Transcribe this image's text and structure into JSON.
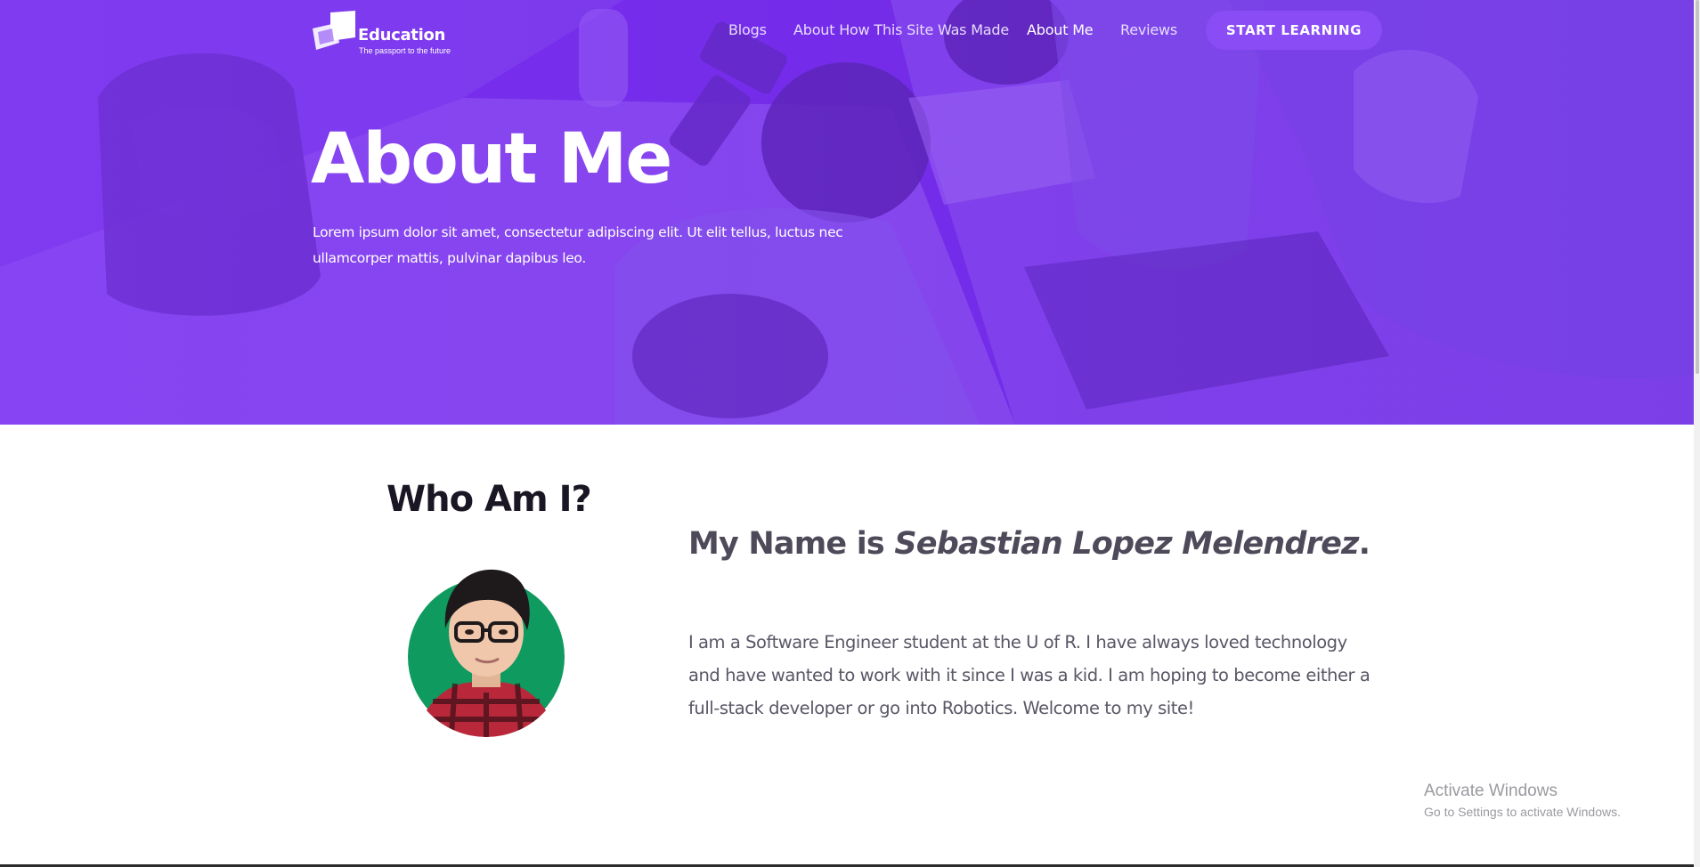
{
  "brand": {
    "name": "Education",
    "tagline": "The passport to the future"
  },
  "nav": {
    "items": [
      {
        "label": "Blogs",
        "active": false
      },
      {
        "label": "About How This Site Was Made",
        "active": false
      },
      {
        "label": "About Me",
        "active": true
      },
      {
        "label": "Reviews",
        "active": false
      }
    ],
    "cta_label": "START LEARNING"
  },
  "hero": {
    "title": "About Me",
    "subtitle": "Lorem ipsum dolor sit amet, consectetur adipiscing elit. Ut elit tellus, luctus nec ullamcorper mattis, pulvinar dapibus leo."
  },
  "about": {
    "heading": "Who Am I?",
    "name_prefix": "My Name is ",
    "name": "Sebastian Lopez Melendrez",
    "name_suffix": ".",
    "bio": "I am a Software Engineer student at the U of R. I have always loved technology and have wanted to work with it since I was a kid. I am hoping to become either a full-stack developer or go into Robotics. Welcome to my site!"
  },
  "watermark": {
    "title": "Activate Windows",
    "subtitle": "Go to Settings to activate Windows."
  },
  "colors": {
    "hero_purple": "#7a33f0",
    "cta_purple": "#8a4cf4",
    "heading_dark": "#1a1624",
    "text_gray": "#5a5766",
    "avatar_bg_green": "#0f9a5f"
  },
  "icons": {
    "logo": "education-logo-icon",
    "avatar": "user-avatar-illustration"
  }
}
